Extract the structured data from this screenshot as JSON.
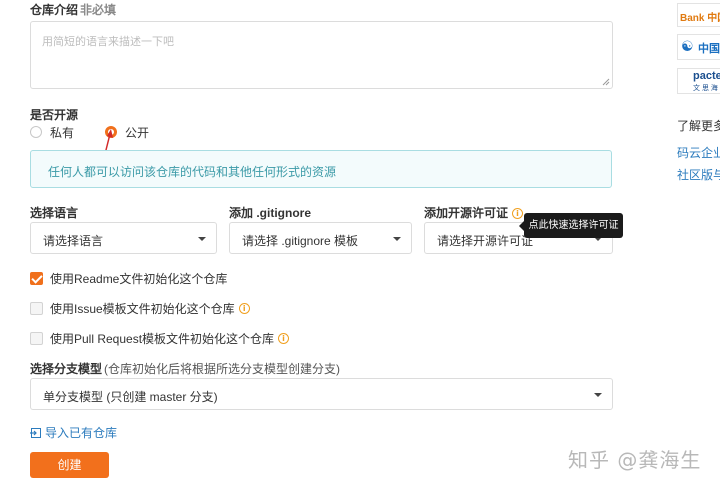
{
  "description_section": {
    "label": "仓库介绍",
    "optional_note": "非必填",
    "placeholder": "用简短的语言来描述一下吧"
  },
  "open_source": {
    "label": "是否开源",
    "options": [
      {
        "label": "私有",
        "checked": false
      },
      {
        "label": "公开",
        "checked": true
      }
    ],
    "info_text": "任何人都可以访问该仓库的代码和其他任何形式的资源"
  },
  "language": {
    "label": "选择语言",
    "selected": "请选择语言"
  },
  "gitignore": {
    "label": "添加 .gitignore",
    "selected": "请选择 .gitignore 模板"
  },
  "license": {
    "label": "添加开源许可证",
    "selected": "请选择开源许可证",
    "tooltip": "点此快速选择许可证"
  },
  "init_options": [
    {
      "label": "使用Readme文件初始化这个仓库",
      "checked": true,
      "has_info": false
    },
    {
      "label": "使用Issue模板文件初始化这个仓库",
      "checked": false,
      "has_info": true
    },
    {
      "label": "使用Pull Request模板文件初始化这个仓库",
      "checked": false,
      "has_info": true
    }
  ],
  "branch_model": {
    "label": "选择分支模型",
    "note": "(仓库初始化后将根据所选分支模型创建分支)",
    "selected": "单分支模型 (只创建 master 分支)"
  },
  "import_link": "导入已有仓库",
  "create_button": "创建",
  "sidebar": {
    "logos": [
      {
        "name": "bank-logo",
        "text": "Bank 中国"
      },
      {
        "name": "china-telecom-logo",
        "text": "中国"
      },
      {
        "name": "pactera-logo",
        "text": "pacte",
        "sub": "文 思 海"
      }
    ],
    "links": [
      {
        "text": "了解更多",
        "color": "#333333"
      },
      {
        "text": "码云企业",
        "color": "#2b7bbd"
      },
      {
        "text": "社区版与",
        "color": "#2b7bbd"
      }
    ]
  },
  "watermark": "知乎 @龚海生",
  "colors": {
    "accent": "#f0701c",
    "info_text": "#3b9aa7",
    "link": "#2b7bbd"
  }
}
